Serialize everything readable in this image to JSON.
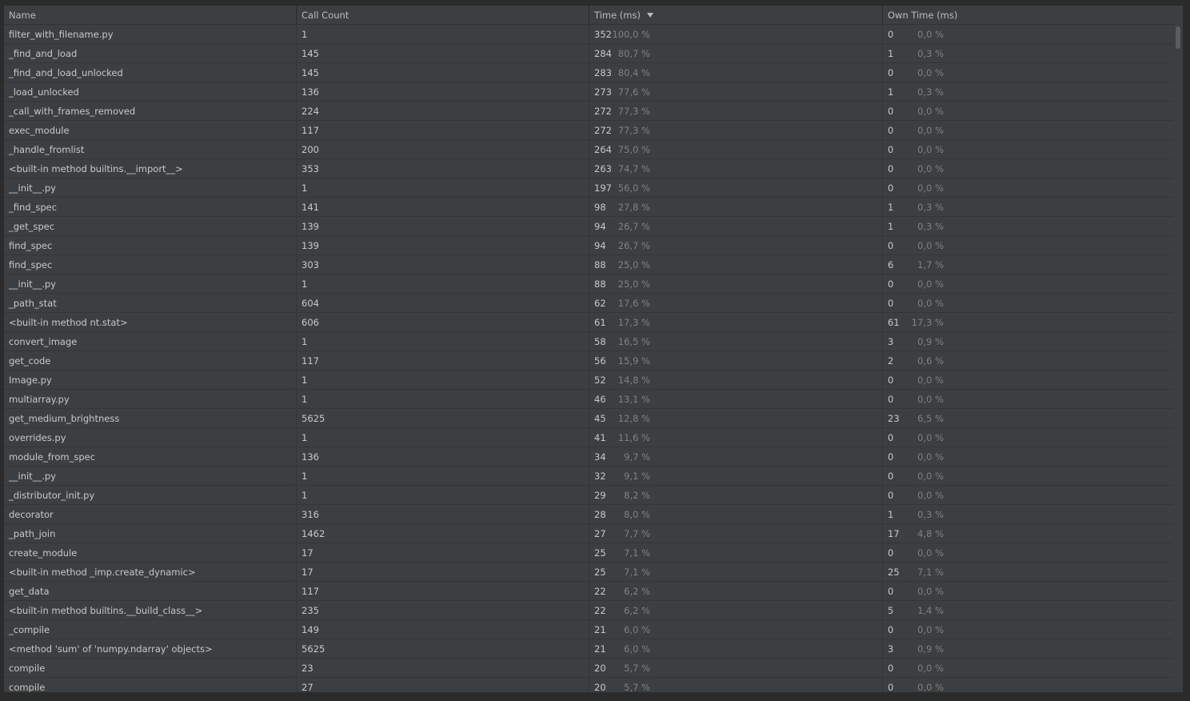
{
  "columns": {
    "name": "Name",
    "calls": "Call Count",
    "time": "Time (ms)",
    "own": "Own Time (ms)"
  },
  "sort": {
    "column": "time",
    "icon": "sort-descending-icon"
  },
  "rows": [
    {
      "name": "filter_with_filename.py",
      "calls": "1",
      "time": "352",
      "time_pct": "100,0 %",
      "own": "0",
      "own_pct": "0,0 %"
    },
    {
      "name": "_find_and_load",
      "calls": "145",
      "time": "284",
      "time_pct": "80,7 %",
      "own": "1",
      "own_pct": "0,3 %"
    },
    {
      "name": "_find_and_load_unlocked",
      "calls": "145",
      "time": "283",
      "time_pct": "80,4 %",
      "own": "0",
      "own_pct": "0,0 %"
    },
    {
      "name": "_load_unlocked",
      "calls": "136",
      "time": "273",
      "time_pct": "77,6 %",
      "own": "1",
      "own_pct": "0,3 %"
    },
    {
      "name": "_call_with_frames_removed",
      "calls": "224",
      "time": "272",
      "time_pct": "77,3 %",
      "own": "0",
      "own_pct": "0,0 %"
    },
    {
      "name": "exec_module",
      "calls": "117",
      "time": "272",
      "time_pct": "77,3 %",
      "own": "0",
      "own_pct": "0,0 %"
    },
    {
      "name": "_handle_fromlist",
      "calls": "200",
      "time": "264",
      "time_pct": "75,0 %",
      "own": "0",
      "own_pct": "0,0 %"
    },
    {
      "name": "<built-in method builtins.__import__>",
      "calls": "353",
      "time": "263",
      "time_pct": "74,7 %",
      "own": "0",
      "own_pct": "0,0 %"
    },
    {
      "name": "__init__.py",
      "calls": "1",
      "time": "197",
      "time_pct": "56,0 %",
      "own": "0",
      "own_pct": "0,0 %"
    },
    {
      "name": "_find_spec",
      "calls": "141",
      "time": "98",
      "time_pct": "27,8 %",
      "own": "1",
      "own_pct": "0,3 %"
    },
    {
      "name": "_get_spec",
      "calls": "139",
      "time": "94",
      "time_pct": "26,7 %",
      "own": "1",
      "own_pct": "0,3 %"
    },
    {
      "name": "find_spec",
      "calls": "139",
      "time": "94",
      "time_pct": "26,7 %",
      "own": "0",
      "own_pct": "0,0 %"
    },
    {
      "name": "find_spec",
      "calls": "303",
      "time": "88",
      "time_pct": "25,0 %",
      "own": "6",
      "own_pct": "1,7 %"
    },
    {
      "name": "__init__.py",
      "calls": "1",
      "time": "88",
      "time_pct": "25,0 %",
      "own": "0",
      "own_pct": "0,0 %"
    },
    {
      "name": "_path_stat",
      "calls": "604",
      "time": "62",
      "time_pct": "17,6 %",
      "own": "0",
      "own_pct": "0,0 %"
    },
    {
      "name": "<built-in method nt.stat>",
      "calls": "606",
      "time": "61",
      "time_pct": "17,3 %",
      "own": "61",
      "own_pct": "17,3 %"
    },
    {
      "name": "convert_image",
      "calls": "1",
      "time": "58",
      "time_pct": "16,5 %",
      "own": "3",
      "own_pct": "0,9 %"
    },
    {
      "name": "get_code",
      "calls": "117",
      "time": "56",
      "time_pct": "15,9 %",
      "own": "2",
      "own_pct": "0,6 %"
    },
    {
      "name": "Image.py",
      "calls": "1",
      "time": "52",
      "time_pct": "14,8 %",
      "own": "0",
      "own_pct": "0,0 %"
    },
    {
      "name": "multiarray.py",
      "calls": "1",
      "time": "46",
      "time_pct": "13,1 %",
      "own": "0",
      "own_pct": "0,0 %"
    },
    {
      "name": "get_medium_brightness",
      "calls": "5625",
      "time": "45",
      "time_pct": "12,8 %",
      "own": "23",
      "own_pct": "6,5 %"
    },
    {
      "name": "overrides.py",
      "calls": "1",
      "time": "41",
      "time_pct": "11,6 %",
      "own": "0",
      "own_pct": "0,0 %"
    },
    {
      "name": "module_from_spec",
      "calls": "136",
      "time": "34",
      "time_pct": "9,7 %",
      "own": "0",
      "own_pct": "0,0 %"
    },
    {
      "name": "__init__.py",
      "calls": "1",
      "time": "32",
      "time_pct": "9,1 %",
      "own": "0",
      "own_pct": "0,0 %"
    },
    {
      "name": "_distributor_init.py",
      "calls": "1",
      "time": "29",
      "time_pct": "8,2 %",
      "own": "0",
      "own_pct": "0,0 %"
    },
    {
      "name": "decorator",
      "calls": "316",
      "time": "28",
      "time_pct": "8,0 %",
      "own": "1",
      "own_pct": "0,3 %"
    },
    {
      "name": "_path_join",
      "calls": "1462",
      "time": "27",
      "time_pct": "7,7 %",
      "own": "17",
      "own_pct": "4,8 %"
    },
    {
      "name": "create_module",
      "calls": "17",
      "time": "25",
      "time_pct": "7,1 %",
      "own": "0",
      "own_pct": "0,0 %"
    },
    {
      "name": "<built-in method _imp.create_dynamic>",
      "calls": "17",
      "time": "25",
      "time_pct": "7,1 %",
      "own": "25",
      "own_pct": "7,1 %"
    },
    {
      "name": "get_data",
      "calls": "117",
      "time": "22",
      "time_pct": "6,2 %",
      "own": "0",
      "own_pct": "0,0 %"
    },
    {
      "name": "<built-in method builtins.__build_class__>",
      "calls": "235",
      "time": "22",
      "time_pct": "6,2 %",
      "own": "5",
      "own_pct": "1,4 %"
    },
    {
      "name": "_compile",
      "calls": "149",
      "time": "21",
      "time_pct": "6,0 %",
      "own": "0",
      "own_pct": "0,0 %"
    },
    {
      "name": "<method 'sum' of 'numpy.ndarray' objects>",
      "calls": "5625",
      "time": "21",
      "time_pct": "6,0 %",
      "own": "3",
      "own_pct": "0,9 %"
    },
    {
      "name": "compile",
      "calls": "23",
      "time": "20",
      "time_pct": "5,7 %",
      "own": "0",
      "own_pct": "0,0 %"
    },
    {
      "name": "compile",
      "calls": "27",
      "time": "20",
      "time_pct": "5,7 %",
      "own": "0",
      "own_pct": "0,0 %"
    }
  ]
}
